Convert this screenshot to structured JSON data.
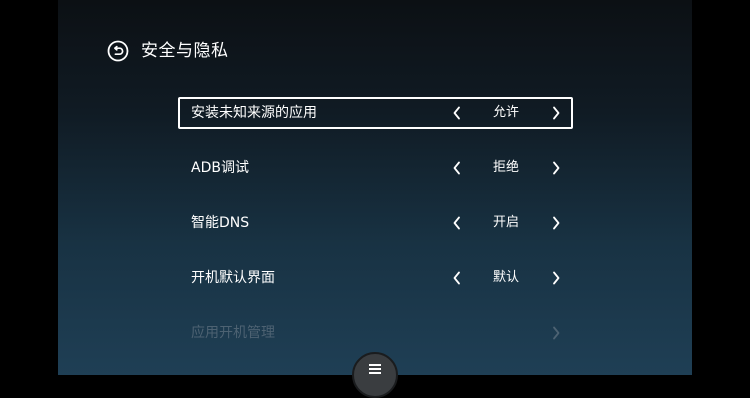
{
  "header": {
    "title": "安全与隐私",
    "back_icon": "back-arrow-circle-icon"
  },
  "settings": [
    {
      "label": "安装未知来源的应用",
      "value": "允许",
      "selected": true,
      "enabled": true
    },
    {
      "label": "ADB调试",
      "value": "拒绝",
      "selected": false,
      "enabled": true
    },
    {
      "label": "智能DNS",
      "value": "开启",
      "selected": false,
      "enabled": true
    },
    {
      "label": "开机默认界面",
      "value": "默认",
      "selected": false,
      "enabled": true
    },
    {
      "label": "应用开机管理",
      "value": "",
      "selected": false,
      "enabled": false
    }
  ],
  "menu_button": {
    "icon": "menu-hamburger-icon"
  },
  "colors": {
    "text": "#ffffff",
    "disabled_text": "#4d6272",
    "selection_border": "#ffffff",
    "background_top": "#0c1014",
    "background_bottom": "#1f3f55"
  }
}
